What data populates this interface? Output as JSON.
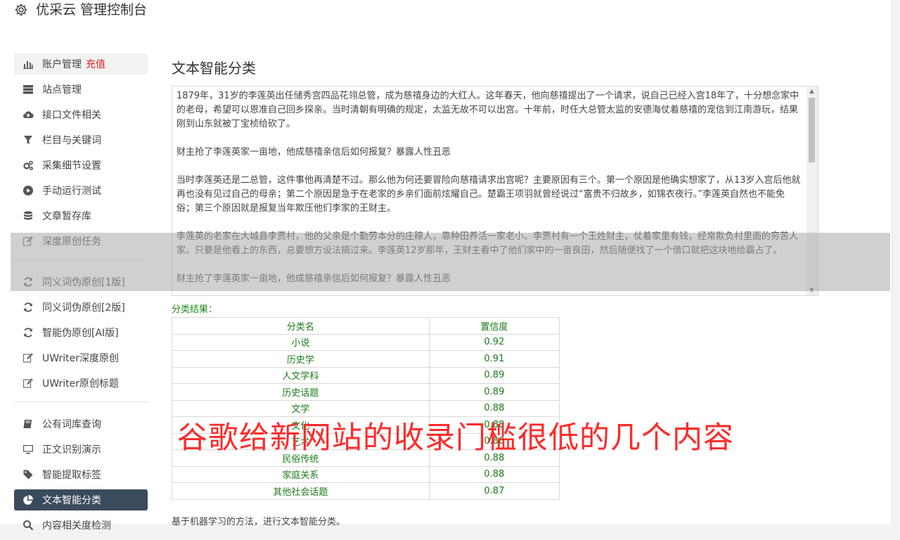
{
  "app": {
    "title": "优采云 管理控制台"
  },
  "sidebar": {
    "groups": [
      [
        {
          "label": "账户管理",
          "badge": "充值",
          "icon": "bar-chart-icon"
        },
        {
          "label": "站点管理",
          "icon": "server-icon"
        },
        {
          "label": "接口文件相关",
          "icon": "cloud-upload-icon"
        },
        {
          "label": "栏目与关键词",
          "icon": "filter-icon"
        },
        {
          "label": "采集细节设置",
          "icon": "cogs-icon"
        },
        {
          "label": "手动运行测试",
          "icon": "play-circle-icon"
        },
        {
          "label": "文章暂存库",
          "icon": "database-icon"
        },
        {
          "label": "深度原创任务",
          "icon": "edit-icon"
        }
      ],
      [
        {
          "label": "同义词伪原创[1版]",
          "icon": "refresh-icon"
        },
        {
          "label": "同义词伪原创[2版]",
          "icon": "refresh-icon"
        },
        {
          "label": "智能伪原创[AI版]",
          "icon": "refresh-icon"
        },
        {
          "label": "UWriter深度原创",
          "icon": "edit-icon"
        },
        {
          "label": "UWriter原创标题",
          "icon": "edit-icon"
        }
      ],
      [
        {
          "label": "公有词库查询",
          "icon": "book-icon"
        },
        {
          "label": "正文识别演示",
          "icon": "monitor-icon"
        },
        {
          "label": "智能提取标签",
          "icon": "tag-icon"
        },
        {
          "label": "文本智能分类",
          "icon": "pie-chart-icon",
          "active": true
        },
        {
          "label": "内容相关度检测",
          "icon": "search-icon"
        }
      ]
    ]
  },
  "main": {
    "title": "文本智能分类",
    "text_paragraphs": [
      "1879年，31岁的李莲英出任储秀宫四品花翎总管，成为慈禧身边的大红人。这年春天，他向慈禧提出了一个请求，说自己已经入宫18年了，十分想念家中的老母，希望可以恩准自己回乡探亲。当时清朝有明确的规定，太监无故不可以出宫。十年前，时任大总管太监的安德海仗着慈禧的宠信到江南游玩，结果刚到山东就被丁宝桢给砍了。",
      "财主抢了李莲英家一亩地，他成慈禧亲信后如何报复？暴露人性丑恶",
      "当时李莲英还是二总管，这件事他再清楚不过。那么他为何还要冒险向慈禧请求出宫呢？主要原因有三个。第一个原因是他确实想家了，从13岁入宫后他就再也没有见过自己的母亲；第二个原因是急于在老家的乡亲们面前炫耀自己。楚霸王项羽就曾经说过“富贵不归故乡，如锦衣夜行。”李莲英自然也不能免俗；第三个原因就是报复当年欺压他们李家的王财主。",
      "李莲英的老家在大城县李贾村，他的父亲是个勤劳本分的庄稼人，靠种田养活一家老小。李贾村有一个王姓财主，仗着家里有钱，经常欺负村里面的穷苦人家。只要是他看上的东西，总要想方设法搞过来。李莲英12岁那年，王财主看中了他们家中的一亩良田，然后随便找了一个借口就把这块地给霸占了。",
      "财主抢了李莲英家一亩地，他成慈禧亲信后如何报复？暴露人性丑恶"
    ],
    "result_label": "分类结果：",
    "table": {
      "headers": [
        "分类名",
        "置信度"
      ],
      "rows": [
        [
          "小说",
          "0.92"
        ],
        [
          "历史学",
          "0.91"
        ],
        [
          "人文学科",
          "0.89"
        ],
        [
          "历史话题",
          "0.89"
        ],
        [
          "文学",
          "0.88"
        ],
        [
          "文化",
          "0.88"
        ],
        [
          "艺术",
          "0.88"
        ],
        [
          "民俗传统",
          "0.88"
        ],
        [
          "家庭关系",
          "0.88"
        ],
        [
          "其他社会话题",
          "0.87"
        ]
      ]
    },
    "footnote": "基于机器学习的方法，进行文本智能分类。"
  },
  "overlay": {
    "text": "谷歌给新网站的收录门槛很低的几个内容"
  },
  "colors": {
    "active_bg": "#3b4b5c",
    "recharge": "#e02020",
    "result_green": "#1a7a1a",
    "overlay_red": "#ff2a2a"
  }
}
